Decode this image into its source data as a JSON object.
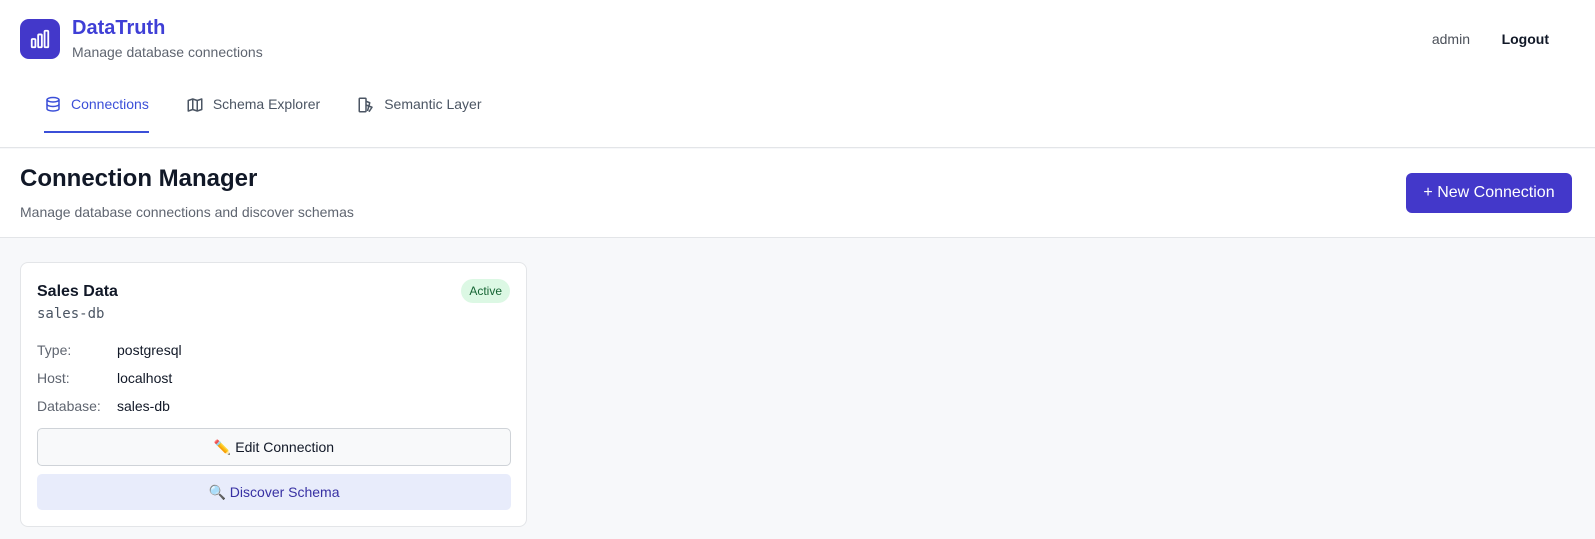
{
  "brand": {
    "title": "DataTruth",
    "subtitle": "Manage database connections",
    "logo_icon": "bar-chart-icon"
  },
  "user": {
    "name": "admin",
    "logout_label": "Logout"
  },
  "tabs": [
    {
      "label": "Connections",
      "icon": "database-icon",
      "active": true
    },
    {
      "label": "Schema Explorer",
      "icon": "map-icon",
      "active": false
    },
    {
      "label": "Semantic Layer",
      "icon": "layers-icon",
      "active": false
    }
  ],
  "page": {
    "title": "Connection Manager",
    "subtitle": "Manage database connections and discover schemas",
    "new_button_label": "+ New Connection"
  },
  "connections": [
    {
      "name": "Sales Data",
      "id": "sales-db",
      "status": "Active",
      "fields": [
        {
          "label": "Type:",
          "value": "postgresql"
        },
        {
          "label": "Host:",
          "value": "localhost"
        },
        {
          "label": "Database:",
          "value": "sales-db"
        }
      ],
      "edit_label": "✏️ Edit Connection",
      "discover_label": "🔍 Discover Schema"
    }
  ],
  "colors": {
    "accent": "#4338ca",
    "active_tab": "#3b4fd8",
    "status_active_bg": "#dcf8e4",
    "status_active_text": "#166534"
  }
}
